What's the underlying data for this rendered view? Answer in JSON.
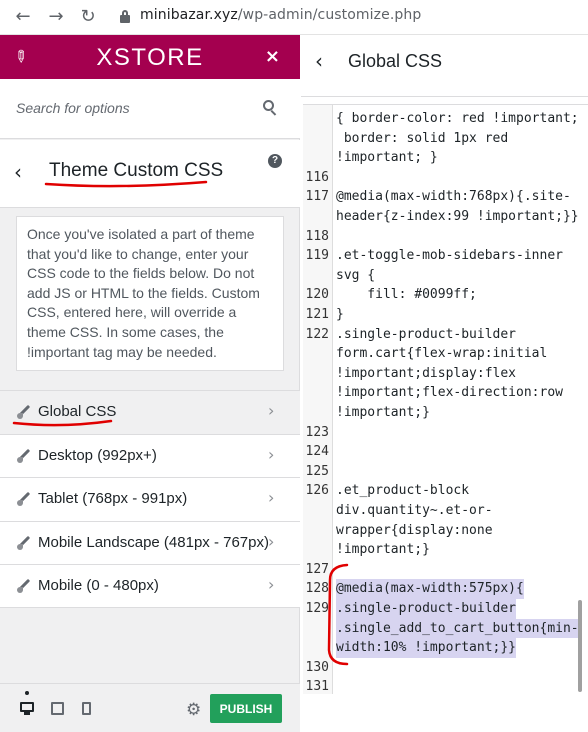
{
  "browser": {
    "url_domain": "minibazar.xyz",
    "url_path": "/wp-admin/customize.php"
  },
  "sidebar": {
    "brand": "XSTORE",
    "close": "×",
    "search_placeholder": "Search for options",
    "section_back": "‹",
    "section_title": "Theme Custom CSS",
    "help": "?",
    "description": "Once you've isolated a part of theme that you'd like to change, enter your CSS code to the fields below. Do not add JS or HTML to the fields. Custom CSS, entered here, will override a theme CSS. In some cases, the !important tag may be needed.",
    "items": [
      {
        "label": "Global CSS",
        "chevron": "›"
      },
      {
        "label": "Desktop (992px+)",
        "chevron": "›"
      },
      {
        "label": "Tablet (768px - 991px)",
        "chevron": "›"
      },
      {
        "label": "Mobile Landscape (481px - 767px)",
        "chevron": "›"
      },
      {
        "label": "Mobile (0 - 480px)",
        "chevron": "›"
      }
    ],
    "publish": "PUBLISH"
  },
  "panel": {
    "back": "‹",
    "title": "Global CSS"
  },
  "editor": {
    "lines": [
      {
        "n": "",
        "t": "{ border-color: red !important;"
      },
      {
        "n": "",
        "t": " border: solid 1px red"
      },
      {
        "n": "",
        "t": "!important; }"
      },
      {
        "n": "116",
        "t": ""
      },
      {
        "n": "117",
        "t": "@media(max-width:768px){.site-"
      },
      {
        "n": "",
        "t": "header{z-index:99 !important;}}"
      },
      {
        "n": "118",
        "t": ""
      },
      {
        "n": "119",
        "t": ".et-toggle-mob-sidebars-inner"
      },
      {
        "n": "",
        "t": "svg {"
      },
      {
        "n": "120",
        "t": "    fill: #0099ff;"
      },
      {
        "n": "121",
        "t": "}"
      },
      {
        "n": "122",
        "t": ".single-product-builder"
      },
      {
        "n": "",
        "t": "form.cart{flex-wrap:initial"
      },
      {
        "n": "",
        "t": "!important;display:flex"
      },
      {
        "n": "",
        "t": "!important;flex-direction:row"
      },
      {
        "n": "",
        "t": "!important;}"
      },
      {
        "n": "123",
        "t": ""
      },
      {
        "n": "124",
        "t": ""
      },
      {
        "n": "125",
        "t": ""
      },
      {
        "n": "126",
        "t": ".et_product-block"
      },
      {
        "n": "",
        "t": "div.quantity~.et-or-"
      },
      {
        "n": "",
        "t": "wrapper{display:none"
      },
      {
        "n": "",
        "t": "!important;}"
      },
      {
        "n": "127",
        "t": ""
      },
      {
        "n": "128",
        "t": "@media(max-width:575px){"
      },
      {
        "n": "129",
        "t": ".single-product-builder"
      },
      {
        "n": "",
        "t": ".single_add_to_cart_button{min-"
      },
      {
        "n": "",
        "t": "width:10% !important;}}"
      },
      {
        "n": "130",
        "t": ""
      },
      {
        "n": "131",
        "t": ""
      }
    ]
  },
  "colors": {
    "brand": "#a4004f",
    "publish": "#22a05b",
    "annotation": "#e00000"
  }
}
